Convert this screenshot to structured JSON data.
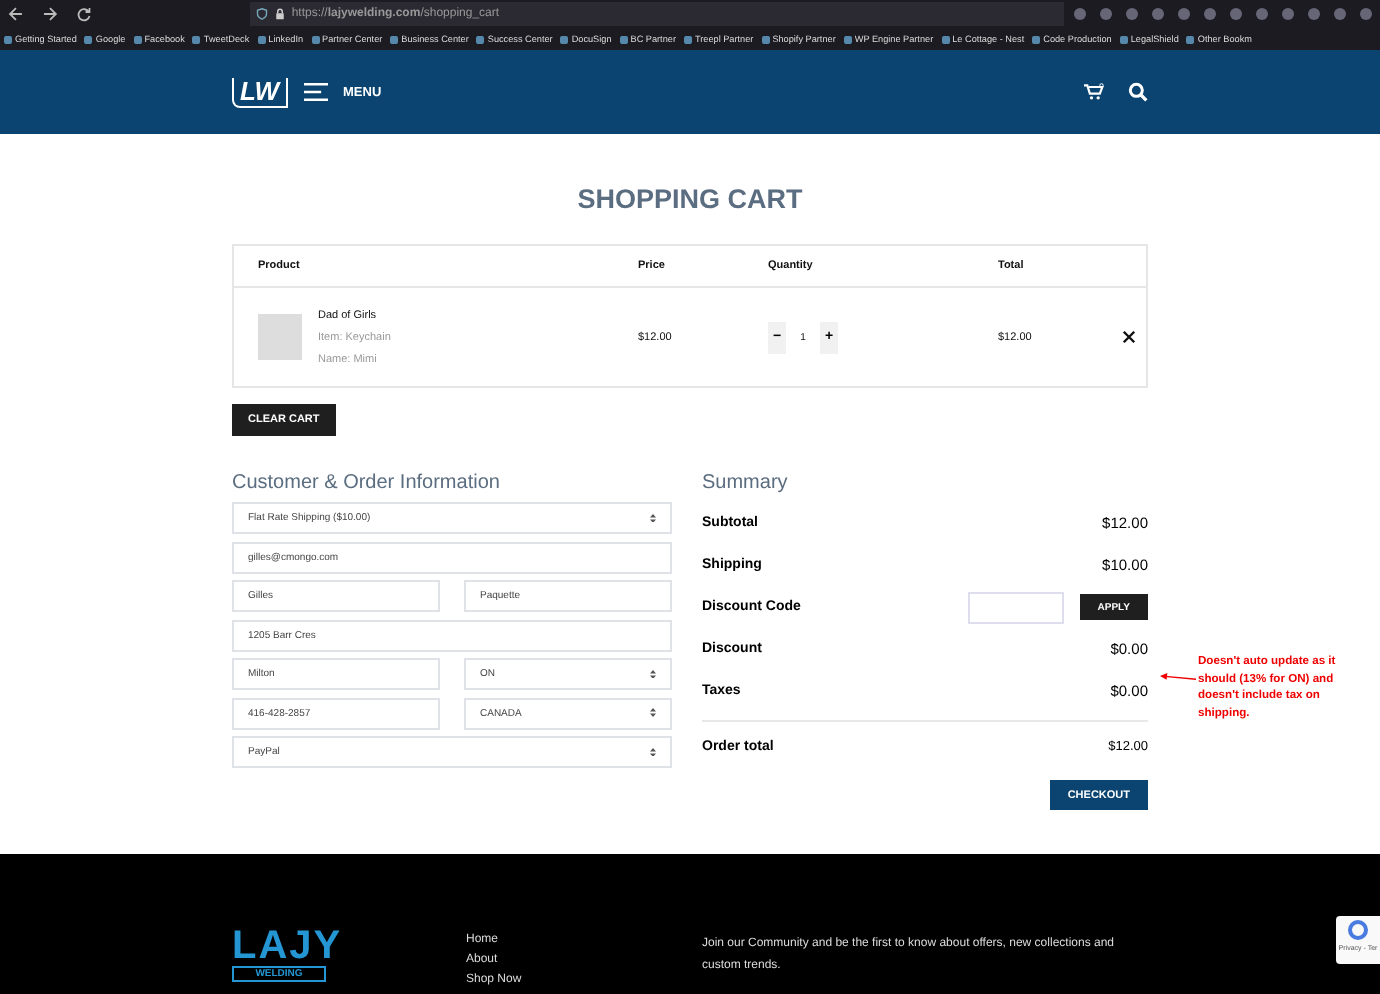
{
  "browser": {
    "url": "https://**lajywelding.com**/shopping_cart",
    "bookmarks": [
      "Getting Started",
      "Google",
      "Facebook",
      "TweetDeck",
      "LinkedIn",
      "Partner Center",
      "Business Center",
      "Success Center",
      "DocuSign",
      "BC Partner",
      "Treepl Partner",
      "Shopify Partner",
      "WP Engine Partner",
      "Le Cottage - Nest",
      "Code Production",
      "LegalShield",
      "Other Bookm"
    ]
  },
  "header": {
    "logo": "LW",
    "menu_label": "MENU"
  },
  "cart": {
    "title": "SHOPPING CART",
    "columns": [
      "Product",
      "Price",
      "Quantity",
      "Total"
    ],
    "items": [
      {
        "name": "Dad of Girls",
        "options": [
          "Item: Keychain",
          "Name: Mimi"
        ],
        "price": "$12.00",
        "quantity": "1",
        "total": "$12.00",
        "minus": "−",
        "plus": "+"
      }
    ],
    "clear_button": "CLEAR CART"
  },
  "customer": {
    "heading": "Customer & Order Information",
    "rows": [
      [
        {
          "kind": "select",
          "value": "Flat Rate Shipping ($10.00)"
        }
      ],
      [
        {
          "kind": "input",
          "value": "gilles@cmongo.com"
        }
      ],
      [
        {
          "kind": "input",
          "value": "Gilles"
        },
        {
          "kind": "input",
          "value": "Paquette"
        }
      ],
      [
        {
          "kind": "input",
          "value": "1205 Barr Cres"
        }
      ],
      [
        {
          "kind": "input",
          "value": "Milton"
        },
        {
          "kind": "select",
          "value": "ON"
        }
      ],
      [
        {
          "kind": "input",
          "value": "416-428-2857"
        },
        {
          "kind": "select",
          "value": "CANADA"
        }
      ],
      [
        {
          "kind": "select",
          "value": "PayPal"
        }
      ]
    ]
  },
  "summary": {
    "heading": "Summary",
    "rows": [
      {
        "kind": "amount",
        "label": "Subtotal",
        "value": "$12.00"
      },
      {
        "kind": "amount",
        "label": "Shipping",
        "value": "$10.00"
      },
      {
        "kind": "code",
        "label": "Discount Code",
        "button": "APPLY"
      },
      {
        "kind": "amount",
        "label": "Discount",
        "value": "$0.00"
      },
      {
        "kind": "amount",
        "label": "Taxes",
        "value": "$0.00"
      }
    ],
    "total_label": "Order total",
    "total_value": "$12.00",
    "checkout": "CHECKOUT"
  },
  "annotation": "Doesn't auto update as it should (13% for ON) and doesn't include tax on shipping.",
  "footer": {
    "logo_top": "LAJY",
    "logo_bottom": "WELDING",
    "links": [
      "Home",
      "About",
      "Shop Now"
    ],
    "newsletter": "Join our Community and be the first to know about offers, new collections and custom trends.",
    "recaptcha": "Privacy - Ter"
  }
}
